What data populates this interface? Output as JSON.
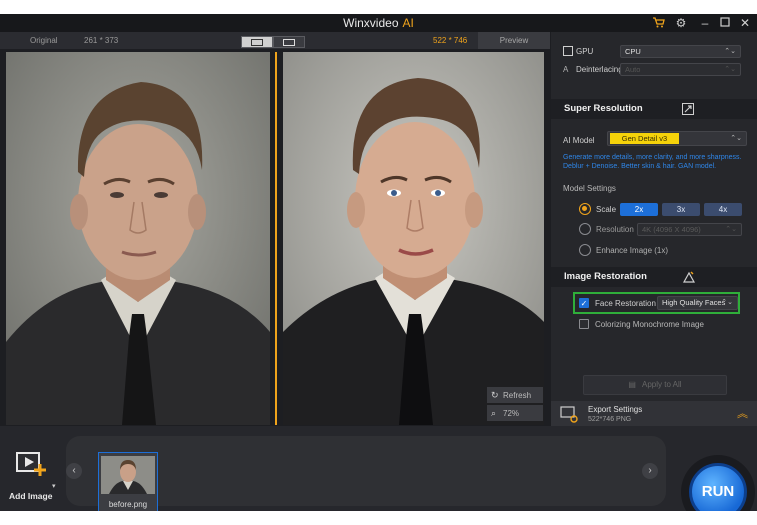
{
  "window": {
    "title_main": "Winxvideo",
    "title_ai": "AI",
    "icons": [
      "cart-icon",
      "gear-icon",
      "minimize-icon",
      "maximize-icon",
      "close-icon"
    ]
  },
  "compare": {
    "original_label": "Original",
    "original_size": "261 * 373",
    "output_size": "522 * 746",
    "preview_label": "Preview",
    "refresh_label": "Refresh",
    "zoom_label": "72%"
  },
  "panel": {
    "gpu_label": "GPU",
    "gpu_value": "CPU",
    "deinterlacing_label": "Deinterlacing",
    "deinterlacing_value": "Auto",
    "super_resolution_title": "Super Resolution",
    "ai_model_label": "AI Model",
    "ai_model_value": "Gen Detail v3",
    "model_description": "Generate more details, more clarity, and more sharpness. Deblur + Denoise. Better skin & hair. GAN model.",
    "model_settings_label": "Model Settings",
    "scale_label": "Scale",
    "scale_options": [
      "2x",
      "3x",
      "4x"
    ],
    "scale_selected": "2x",
    "resolution_label": "Resolution",
    "resolution_value": "4K (4096 X 4096)",
    "enhance_label": "Enhance Image (1x)",
    "image_restoration_title": "Image Restoration",
    "face_restoration_label": "Face Restoration",
    "face_restoration_value": "High Quality Faces",
    "colorizing_label": "Colorizing Monochrome Image",
    "apply_all_label": "Apply to All",
    "export_title": "Export Settings",
    "export_info": "522*746  PNG"
  },
  "bottom": {
    "add_image_label": "Add Image",
    "thumbnail_name": "before.png",
    "run_label": "RUN"
  },
  "colors": {
    "accent_orange": "#f0a41c",
    "accent_blue": "#1d6fd8",
    "highlight_green": "#2fae3a",
    "model_yellow": "#f5d20a"
  }
}
